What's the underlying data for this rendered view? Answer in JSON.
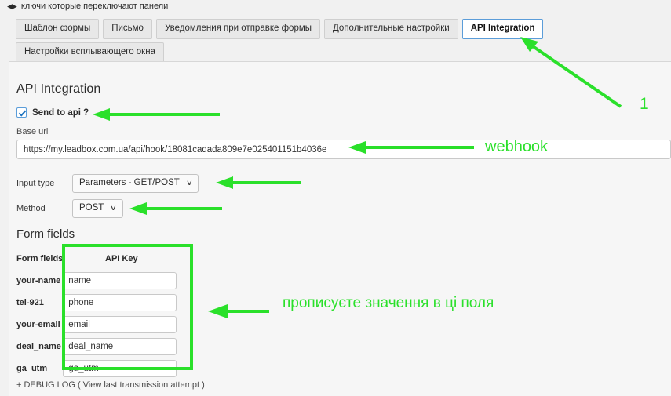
{
  "hint_bar": {
    "icon": "left-right-arrows-icon",
    "glyph": "◀▶",
    "text": "ключи которые переключают панели"
  },
  "tabs": {
    "row1": [
      {
        "label": "Шаблон формы",
        "active": false
      },
      {
        "label": "Письмо",
        "active": false
      },
      {
        "label": "Уведомления при отправке формы",
        "active": false
      },
      {
        "label": "Дополнительные настройки",
        "active": false
      },
      {
        "label": "API Integration",
        "active": true
      }
    ],
    "row2": [
      {
        "label": "Настройки всплывающего окна",
        "active": false
      }
    ]
  },
  "panel": {
    "section_title": "API Integration",
    "send_to_api": {
      "label": "Send to api ?",
      "checked": true
    },
    "base_url": {
      "label": "Base url",
      "value": "https://my.leadbox.com.ua/api/hook/18081cadada809e7e025401151b4036e",
      "placeholder": "Base url"
    },
    "input_type": {
      "label": "Input type",
      "value": "Parameters - GET/POST",
      "caret": "∨"
    },
    "method": {
      "label": "Method",
      "value": "POST",
      "caret": "∨"
    },
    "form_fields": {
      "title": "Form fields",
      "columns": [
        "Form fields",
        "API Key"
      ],
      "rows": [
        {
          "name": "your-name",
          "api_key": "name"
        },
        {
          "name": "tel-921",
          "api_key": "phone"
        },
        {
          "name": "your-email",
          "api_key": "email"
        },
        {
          "name": "deal_name",
          "api_key": "deal_name"
        },
        {
          "name": "ga_utm",
          "api_key": "ga_utm"
        }
      ]
    },
    "debug_log": "+ DEBUG LOG ( View last transmission attempt )"
  },
  "annotations": {
    "color": "#2ae02a",
    "step_number": "1",
    "webhook_label": "webhook",
    "fields_label": "прописуєте значення в ці поля"
  }
}
